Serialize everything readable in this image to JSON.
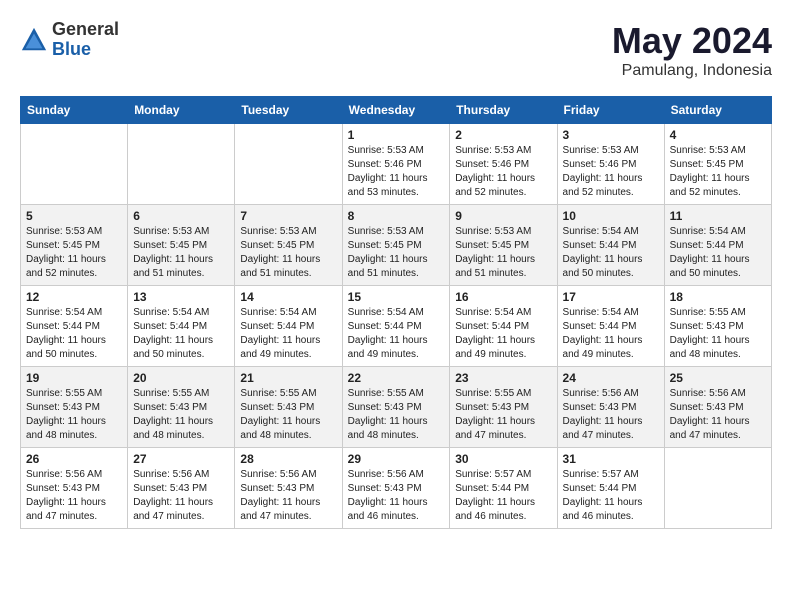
{
  "logo": {
    "general": "General",
    "blue": "Blue"
  },
  "title": {
    "month": "May 2024",
    "location": "Pamulang, Indonesia"
  },
  "headers": [
    "Sunday",
    "Monday",
    "Tuesday",
    "Wednesday",
    "Thursday",
    "Friday",
    "Saturday"
  ],
  "weeks": [
    [
      {
        "day": "",
        "info": ""
      },
      {
        "day": "",
        "info": ""
      },
      {
        "day": "",
        "info": ""
      },
      {
        "day": "1",
        "info": "Sunrise: 5:53 AM\nSunset: 5:46 PM\nDaylight: 11 hours\nand 53 minutes."
      },
      {
        "day": "2",
        "info": "Sunrise: 5:53 AM\nSunset: 5:46 PM\nDaylight: 11 hours\nand 52 minutes."
      },
      {
        "day": "3",
        "info": "Sunrise: 5:53 AM\nSunset: 5:46 PM\nDaylight: 11 hours\nand 52 minutes."
      },
      {
        "day": "4",
        "info": "Sunrise: 5:53 AM\nSunset: 5:45 PM\nDaylight: 11 hours\nand 52 minutes."
      }
    ],
    [
      {
        "day": "5",
        "info": "Sunrise: 5:53 AM\nSunset: 5:45 PM\nDaylight: 11 hours\nand 52 minutes."
      },
      {
        "day": "6",
        "info": "Sunrise: 5:53 AM\nSunset: 5:45 PM\nDaylight: 11 hours\nand 51 minutes."
      },
      {
        "day": "7",
        "info": "Sunrise: 5:53 AM\nSunset: 5:45 PM\nDaylight: 11 hours\nand 51 minutes."
      },
      {
        "day": "8",
        "info": "Sunrise: 5:53 AM\nSunset: 5:45 PM\nDaylight: 11 hours\nand 51 minutes."
      },
      {
        "day": "9",
        "info": "Sunrise: 5:53 AM\nSunset: 5:45 PM\nDaylight: 11 hours\nand 51 minutes."
      },
      {
        "day": "10",
        "info": "Sunrise: 5:54 AM\nSunset: 5:44 PM\nDaylight: 11 hours\nand 50 minutes."
      },
      {
        "day": "11",
        "info": "Sunrise: 5:54 AM\nSunset: 5:44 PM\nDaylight: 11 hours\nand 50 minutes."
      }
    ],
    [
      {
        "day": "12",
        "info": "Sunrise: 5:54 AM\nSunset: 5:44 PM\nDaylight: 11 hours\nand 50 minutes."
      },
      {
        "day": "13",
        "info": "Sunrise: 5:54 AM\nSunset: 5:44 PM\nDaylight: 11 hours\nand 50 minutes."
      },
      {
        "day": "14",
        "info": "Sunrise: 5:54 AM\nSunset: 5:44 PM\nDaylight: 11 hours\nand 49 minutes."
      },
      {
        "day": "15",
        "info": "Sunrise: 5:54 AM\nSunset: 5:44 PM\nDaylight: 11 hours\nand 49 minutes."
      },
      {
        "day": "16",
        "info": "Sunrise: 5:54 AM\nSunset: 5:44 PM\nDaylight: 11 hours\nand 49 minutes."
      },
      {
        "day": "17",
        "info": "Sunrise: 5:54 AM\nSunset: 5:44 PM\nDaylight: 11 hours\nand 49 minutes."
      },
      {
        "day": "18",
        "info": "Sunrise: 5:55 AM\nSunset: 5:43 PM\nDaylight: 11 hours\nand 48 minutes."
      }
    ],
    [
      {
        "day": "19",
        "info": "Sunrise: 5:55 AM\nSunset: 5:43 PM\nDaylight: 11 hours\nand 48 minutes."
      },
      {
        "day": "20",
        "info": "Sunrise: 5:55 AM\nSunset: 5:43 PM\nDaylight: 11 hours\nand 48 minutes."
      },
      {
        "day": "21",
        "info": "Sunrise: 5:55 AM\nSunset: 5:43 PM\nDaylight: 11 hours\nand 48 minutes."
      },
      {
        "day": "22",
        "info": "Sunrise: 5:55 AM\nSunset: 5:43 PM\nDaylight: 11 hours\nand 48 minutes."
      },
      {
        "day": "23",
        "info": "Sunrise: 5:55 AM\nSunset: 5:43 PM\nDaylight: 11 hours\nand 47 minutes."
      },
      {
        "day": "24",
        "info": "Sunrise: 5:56 AM\nSunset: 5:43 PM\nDaylight: 11 hours\nand 47 minutes."
      },
      {
        "day": "25",
        "info": "Sunrise: 5:56 AM\nSunset: 5:43 PM\nDaylight: 11 hours\nand 47 minutes."
      }
    ],
    [
      {
        "day": "26",
        "info": "Sunrise: 5:56 AM\nSunset: 5:43 PM\nDaylight: 11 hours\nand 47 minutes."
      },
      {
        "day": "27",
        "info": "Sunrise: 5:56 AM\nSunset: 5:43 PM\nDaylight: 11 hours\nand 47 minutes."
      },
      {
        "day": "28",
        "info": "Sunrise: 5:56 AM\nSunset: 5:43 PM\nDaylight: 11 hours\nand 47 minutes."
      },
      {
        "day": "29",
        "info": "Sunrise: 5:56 AM\nSunset: 5:43 PM\nDaylight: 11 hours\nand 46 minutes."
      },
      {
        "day": "30",
        "info": "Sunrise: 5:57 AM\nSunset: 5:44 PM\nDaylight: 11 hours\nand 46 minutes."
      },
      {
        "day": "31",
        "info": "Sunrise: 5:57 AM\nSunset: 5:44 PM\nDaylight: 11 hours\nand 46 minutes."
      },
      {
        "day": "",
        "info": ""
      }
    ]
  ]
}
